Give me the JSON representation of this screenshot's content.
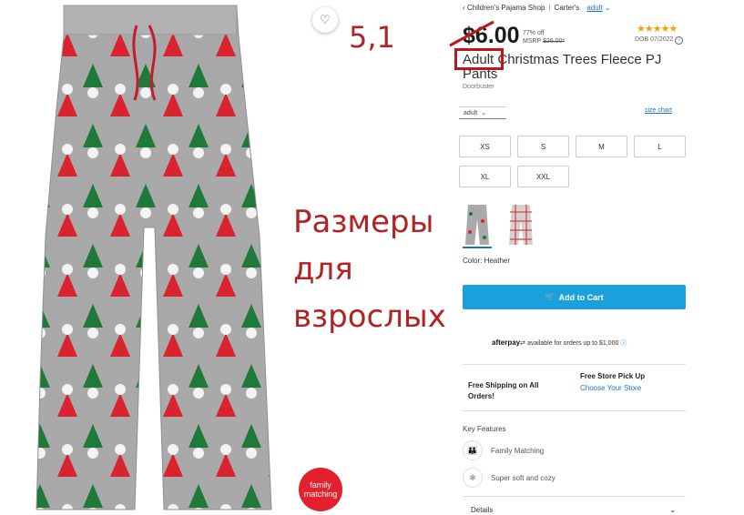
{
  "breadcrumb": {
    "back": "Children's Pajama Shop",
    "brand": "Carter's",
    "current": "adult"
  },
  "price": {
    "current": "$6.00",
    "discount": "77% off",
    "msrp_label": "MSRP",
    "msrp_value": "$26.00*"
  },
  "rating": {
    "stars": "★★★★★",
    "dob": "DOB 07/2022"
  },
  "product": {
    "title": "Adult Christmas Trees Fleece PJ Pants",
    "subtitle": "Doorbuster"
  },
  "size": {
    "selected": "adult",
    "chart_label": "size chart",
    "options": [
      "XS",
      "S",
      "M",
      "L",
      "XL",
      "XXL"
    ]
  },
  "color": {
    "label": "Color: Heather"
  },
  "cart": {
    "label": "Add to Cart"
  },
  "afterpay": {
    "brand": "afterpay",
    "text": "available for orders up to $1,000"
  },
  "shipping": {
    "free": "Free Shipping on All Orders!",
    "pickup": "Free Store Pick Up",
    "choose": "Choose Your Store"
  },
  "features": {
    "heading": "Key Features",
    "items": [
      {
        "icon": "family-icon",
        "label": "Family Matching"
      },
      {
        "icon": "snowflake-icon",
        "label": "Super soft and cozy"
      }
    ]
  },
  "details": {
    "label": "Details"
  },
  "badge": {
    "line1": "family",
    "line2": "matching"
  },
  "annotations": {
    "size": "5,1",
    "line1": "Размеры",
    "line2": "для",
    "line3": "взрослых"
  },
  "colors": {
    "accent": "#1aa0db",
    "annotation": "#b22222",
    "badge": "#e3202c",
    "pants": "#a8a8a8"
  }
}
